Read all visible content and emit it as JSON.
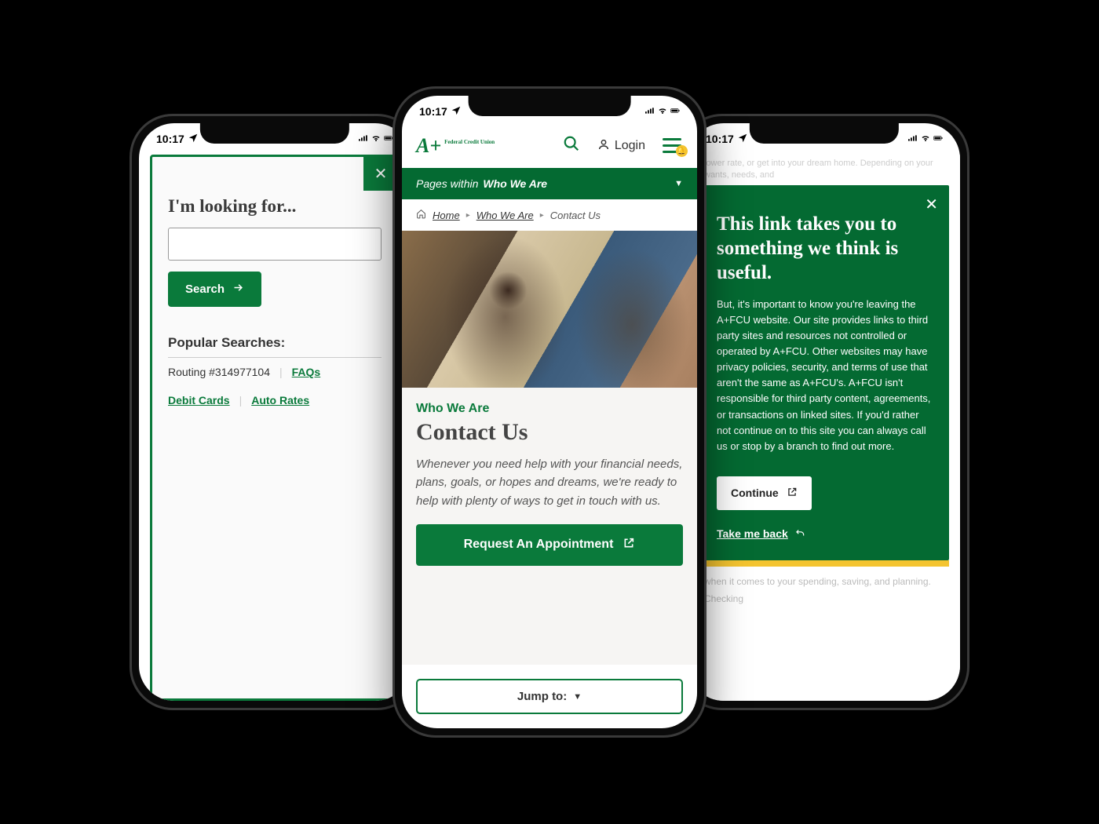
{
  "status": {
    "time": "10:17",
    "location_icon": "location-arrow",
    "signal": "􀙗",
    "wifi": "wifi",
    "battery": "battery"
  },
  "left": {
    "heading": "I'm looking for...",
    "search_value": "",
    "search_button": "Search",
    "popular_title": "Popular Searches:",
    "popular_items": {
      "routing": "Routing #314977104",
      "faqs": "FAQs",
      "debit": "Debit Cards",
      "auto": "Auto Rates"
    }
  },
  "center": {
    "logo_text": "A+",
    "logo_sub": "Federal Credit Union",
    "login_label": "Login",
    "subnav_prefix": "Pages within ",
    "subnav_strong": "Who We Are",
    "crumbs": {
      "home": "Home",
      "section": "Who We Are",
      "current": "Contact Us"
    },
    "overline": "Who We Are",
    "h1": "Contact Us",
    "lead": "Whenever you need help with your financial needs, plans, goals, or hopes and dreams, we're ready to help with plenty of ways to get in touch with us.",
    "cta": "Request An Appointment",
    "jump": "Jump to:"
  },
  "right": {
    "faint_top": "lower rate, or get into your dream home. Depending on your wants, needs, and",
    "heading": "This link takes you to something we think is useful.",
    "body": "But, it's important to know you're leaving the A+FCU website. Our site provides links to third party sites and resources not controlled or operated by A+FCU. Other websites may have privacy policies, security, and terms of use that aren't the same as A+FCU's. A+FCU isn't responsible for third party content, agreements, or transactions on linked sites. If you'd rather not continue on to this site you can always call us or stop by a branch to find out more.",
    "continue": "Continue",
    "back": "Take me back",
    "faint_bottom": "when it comes to your spending, saving, and planning.",
    "faint_item": "Checking"
  }
}
